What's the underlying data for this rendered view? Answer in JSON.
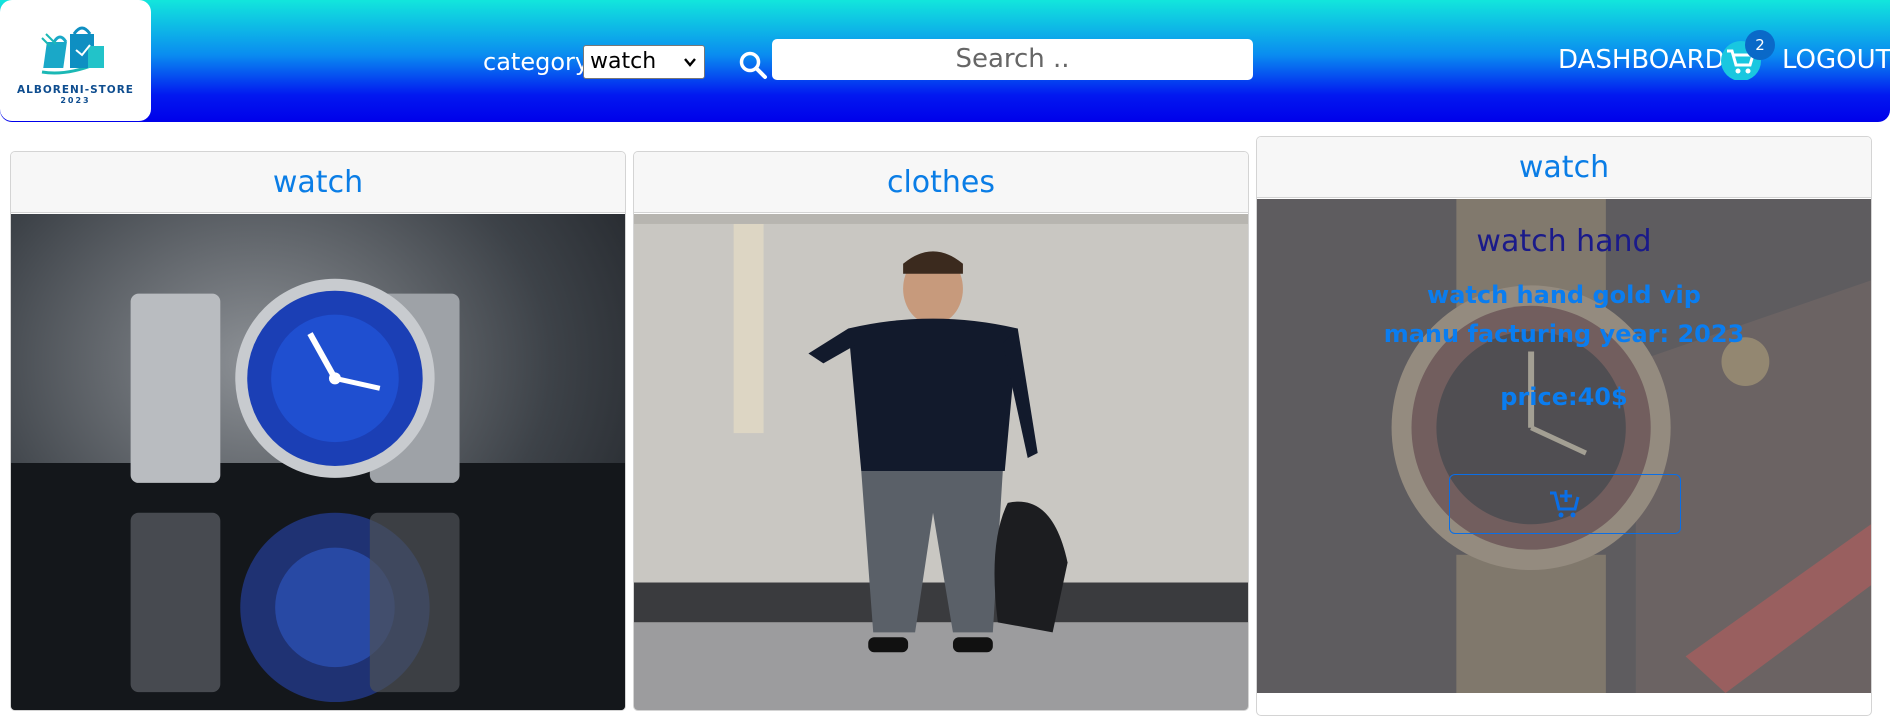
{
  "brand": {
    "logo_name": "ALBORENI-STORE",
    "logo_year": "2023"
  },
  "navbar": {
    "category_label": "category:",
    "category_selected": "watch",
    "search_placeholder": "Search ..",
    "dashboard_label": "DASHBOARD",
    "cart_count": "2",
    "logout_label": "LOGOUT"
  },
  "products": [
    {
      "category": "watch"
    },
    {
      "category": "clothes"
    },
    {
      "category": "watch",
      "title": "watch hand",
      "description": "watch hand gold vip",
      "year_text": "manu facturing year: 2023",
      "price_text": "price:40$"
    }
  ],
  "colors": {
    "navbar_top": "#12e6dc",
    "navbar_bottom": "#0000ea",
    "link_blue": "#0a7de6",
    "badge": "#0a69c8"
  },
  "icons": {
    "search": "search-icon",
    "cart": "cart-icon",
    "add_to_cart": "cart-plus-icon",
    "select": "chevron-down-icon"
  }
}
